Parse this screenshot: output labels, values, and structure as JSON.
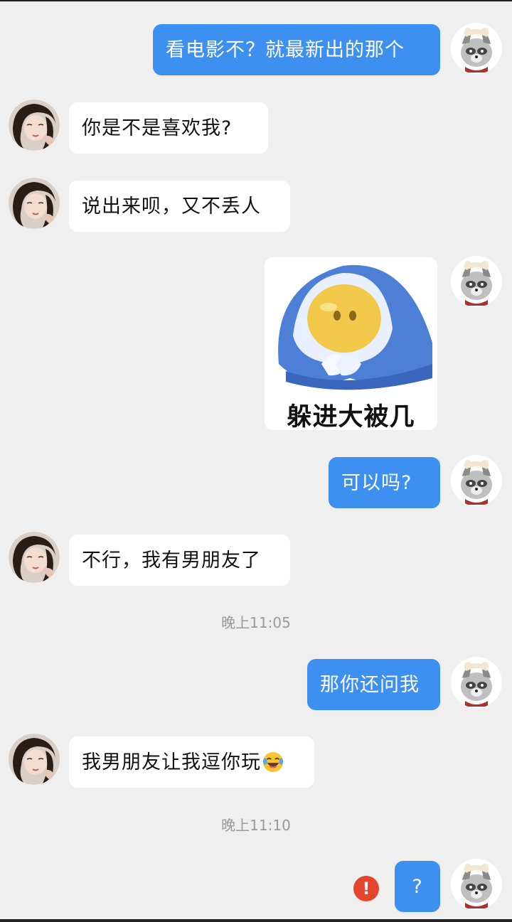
{
  "conversation": {
    "messages": [
      {
        "from": "me",
        "type": "text",
        "text": "看电影不？就最新出的那个"
      },
      {
        "from": "her",
        "type": "text",
        "text": "你是不是喜欢我?"
      },
      {
        "from": "her",
        "type": "text",
        "text": "说出来呗，又不丢人"
      },
      {
        "from": "me",
        "type": "sticker",
        "caption": "躲进大被几"
      },
      {
        "from": "me",
        "type": "text",
        "text": "可以吗?"
      },
      {
        "from": "her",
        "type": "text",
        "text": "不行，我有男朋友了"
      },
      {
        "from": "me",
        "type": "text",
        "text": "那你还问我"
      },
      {
        "from": "her",
        "type": "text",
        "text": "我男朋友让我逗你玩"
      },
      {
        "from": "me",
        "type": "text",
        "text": "?",
        "status": "failed"
      }
    ],
    "timestamps": [
      "晚上11:05",
      "晚上11:10"
    ],
    "emoji": "😂",
    "error_icon": "!"
  },
  "colors": {
    "background": "#efefef",
    "outgoing_bubble": "#3d8ff0",
    "incoming_bubble": "#ffffff",
    "error": "#e5452d"
  },
  "icons": [
    "raccoon-avatar-icon",
    "girl-avatar-icon",
    "send-failed-icon",
    "laughing-emoji-icon"
  ]
}
